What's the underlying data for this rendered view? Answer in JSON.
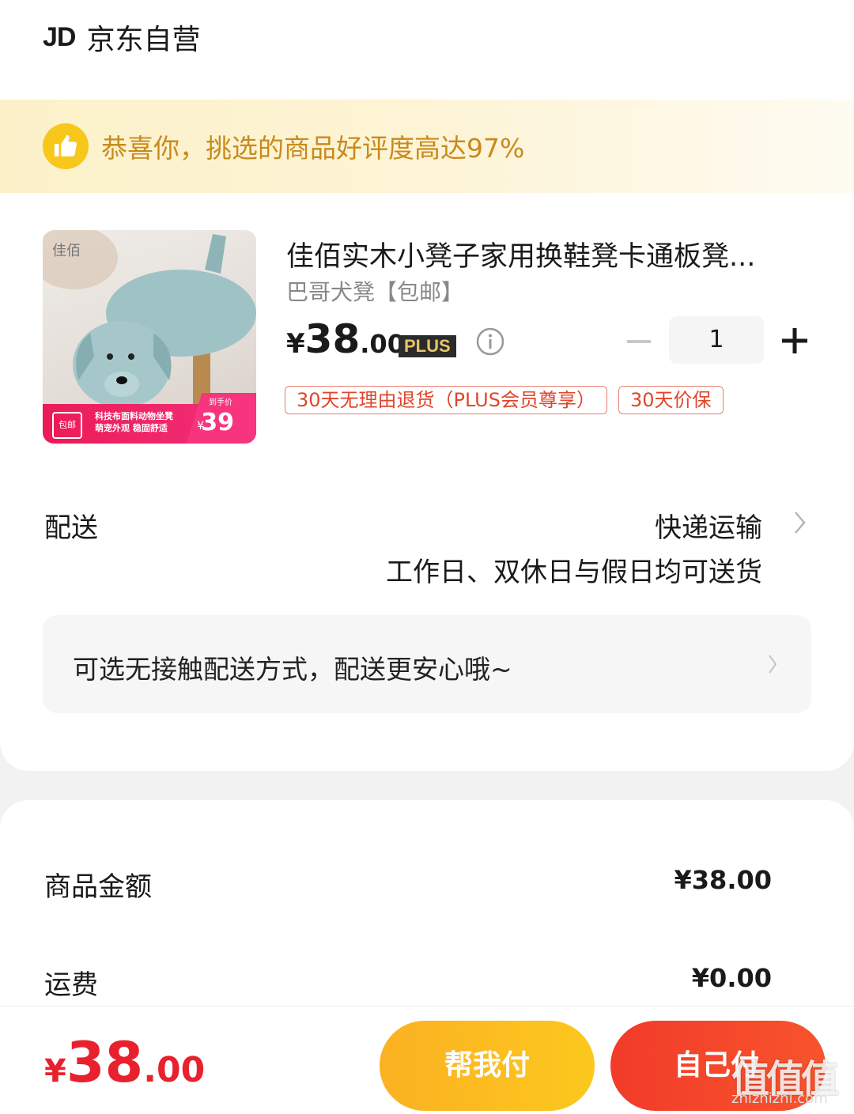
{
  "shop": {
    "logo": "JD",
    "name": "京东自营"
  },
  "praise_banner": {
    "text": "恭喜你，挑选的商品好评度高达97%",
    "icon": "thumbs-up-icon"
  },
  "product": {
    "title": "佳佰实木小凳子家用换鞋凳卡通板凳...",
    "spec": "巴哥犬凳【包邮】",
    "price_yen": "¥",
    "price_int": "38",
    "price_dec": ".00",
    "plus_badge": "PLUS",
    "quantity": "1",
    "tags": [
      "30天无理由退货（PLUS会员尊享）",
      "30天价保"
    ],
    "image": {
      "brand": "佳佰",
      "ribbon_badge": "包邮",
      "ribbon_line1": "科技布面料动物坐凳",
      "ribbon_line2": "萌宠外观 稳固舒适",
      "ribbon_small": "到手价",
      "ribbon_yen": "¥",
      "ribbon_price": "39"
    }
  },
  "delivery": {
    "label": "配送",
    "method": "快递运输",
    "note": "工作日、双休日与假日均可送货",
    "contactless": "可选无接触配送方式，配送更安心哦~"
  },
  "summary": [
    {
      "label": "商品金额",
      "value": "¥38.00"
    },
    {
      "label": "运费",
      "value": "¥0.00"
    }
  ],
  "bottom_bar": {
    "total_yen": "¥",
    "total_int": "38",
    "total_dec": ".00",
    "help_pay_label": "帮我付",
    "self_pay_label": "自己付"
  },
  "watermark": {
    "text": "值值值",
    "url": "zhizhizhi.com"
  },
  "colors": {
    "accent_red": "#e8212f",
    "banner_text": "#c98a1c",
    "help_button": "#fcc81d",
    "pay_button": "#f23b2a"
  }
}
